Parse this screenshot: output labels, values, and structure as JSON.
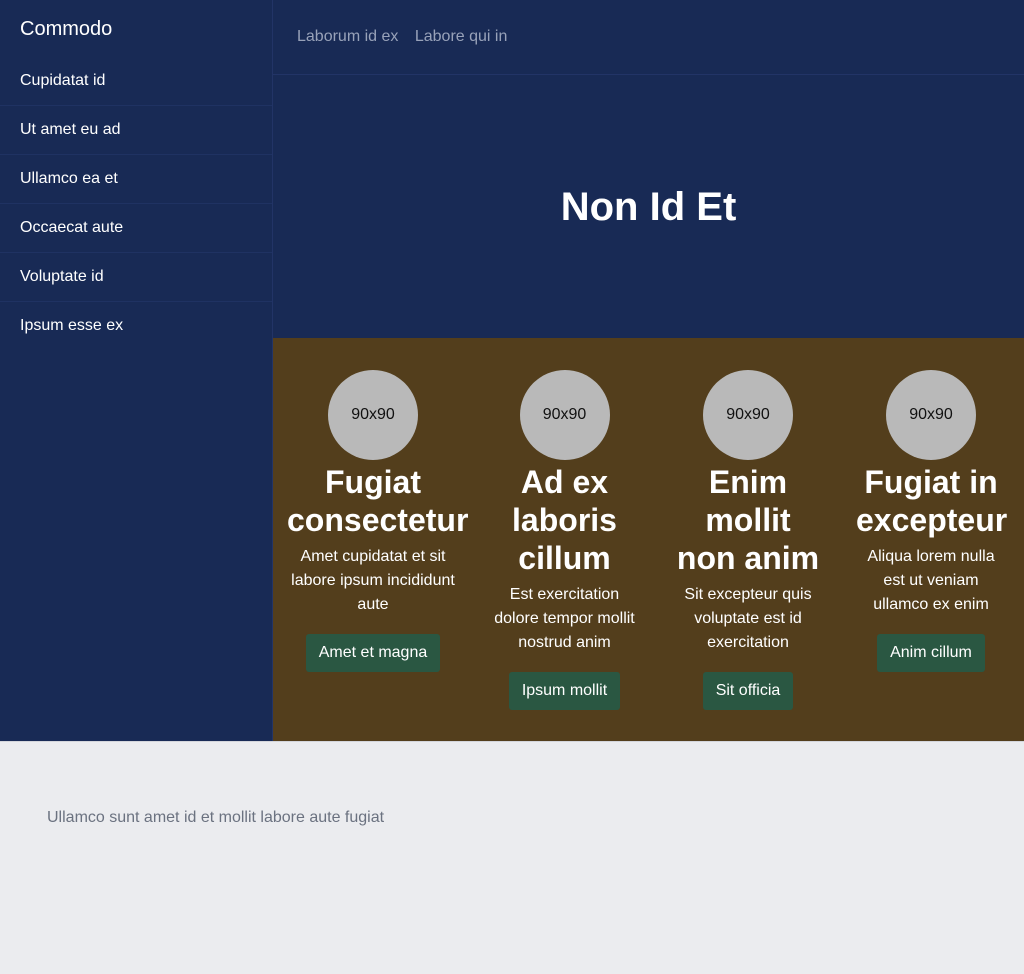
{
  "sidebar": {
    "brand": "Commodo",
    "items": [
      {
        "label": "Cupidatat id"
      },
      {
        "label": "Ut amet eu ad"
      },
      {
        "label": "Ullamco ea et"
      },
      {
        "label": "Occaecat aute"
      },
      {
        "label": "Voluptate id"
      },
      {
        "label": "Ipsum esse ex"
      }
    ]
  },
  "topnav": {
    "links": [
      {
        "label": "Laborum id ex"
      },
      {
        "label": "Labore qui in"
      }
    ]
  },
  "hero": {
    "title": "Non Id Et"
  },
  "features": [
    {
      "avatar": "90x90",
      "title": "Fugiat consectetur",
      "text": "Amet cupidatat et sit labore ipsum incididunt aute",
      "button": "Amet et magna"
    },
    {
      "avatar": "90x90",
      "title": "Ad ex laboris cillum",
      "text": "Est exercitation dolore tempor mollit nostrud anim",
      "button": "Ipsum mollit"
    },
    {
      "avatar": "90x90",
      "title": "Enim mollit non anim",
      "text": "Sit excepteur quis voluptate est id exercitation",
      "button": "Sit officia"
    },
    {
      "avatar": "90x90",
      "title": "Fugiat in excepteur",
      "text": "Aliqua lorem nulla est ut veniam ullamco ex enim",
      "button": "Anim cillum"
    }
  ],
  "footer": {
    "text": "Ullamco sunt amet id et mollit labore aute fugiat"
  },
  "colors": {
    "navy": "#182a55",
    "brown": "#533e1c",
    "button_green": "#2a5742",
    "footer_bg": "#ebecef"
  }
}
